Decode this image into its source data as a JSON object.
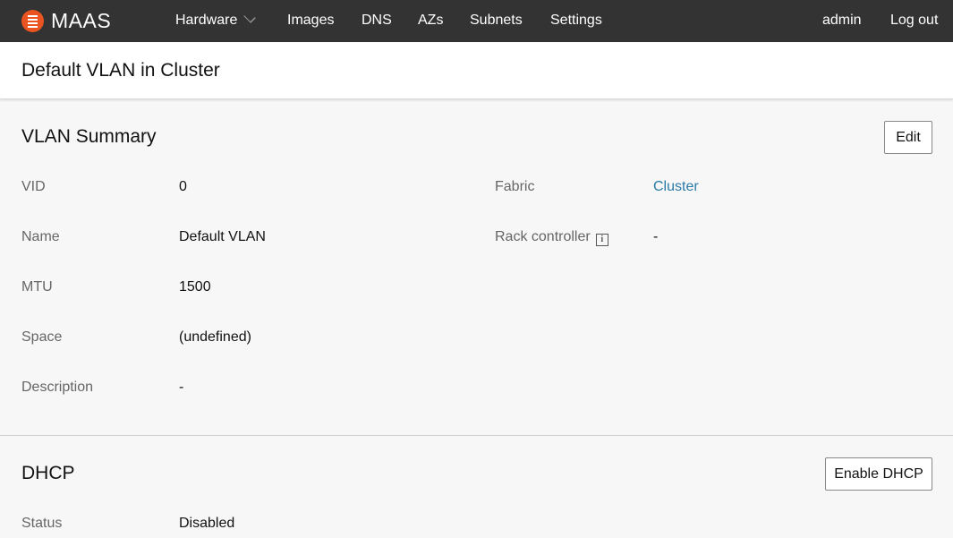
{
  "app": {
    "logo_text": "MAAS",
    "brand_color": "#e95420"
  },
  "nav": {
    "items": [
      {
        "label": "Hardware"
      },
      {
        "label": "Images"
      },
      {
        "label": "DNS"
      },
      {
        "label": "AZs"
      },
      {
        "label": "Subnets"
      },
      {
        "label": "Settings"
      }
    ],
    "user": "admin",
    "logout": "Log out"
  },
  "page": {
    "title": "Default VLAN in Cluster"
  },
  "vlan_summary": {
    "title": "VLAN Summary",
    "edit_label": "Edit",
    "fields": {
      "vid_label": "VID",
      "vid_value": "0",
      "name_label": "Name",
      "name_value": "Default VLAN",
      "mtu_label": "MTU",
      "mtu_value": "1500",
      "space_label": "Space",
      "space_value": "(undefined)",
      "description_label": "Description",
      "description_value": "-",
      "fabric_label": "Fabric",
      "fabric_value": "Cluster",
      "rack_label": "Rack controller",
      "rack_value": "-"
    }
  },
  "dhcp": {
    "title": "DHCP",
    "enable_label": "Enable DHCP",
    "status_label": "Status",
    "status_value": "Disabled"
  }
}
